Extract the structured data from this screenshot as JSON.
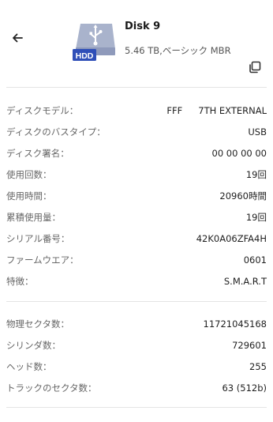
{
  "header": {
    "title": "Disk 9",
    "subtitle": "5.46 TB,ベーシック MBR",
    "icon_badge": "HDD"
  },
  "info_group_1": [
    {
      "label": "ディスクモデル：",
      "value_parts": [
        "FFF",
        "7TH EXTERNAL"
      ]
    },
    {
      "label": "ディスクのバスタイプ：",
      "value": "USB"
    },
    {
      "label": "ディスク署名：",
      "value": "00 00 00 00"
    },
    {
      "label": "使用回数：",
      "value": "19回"
    },
    {
      "label": "使用時間：",
      "value": "20960時間"
    },
    {
      "label": "累積使用量：",
      "value": "19回"
    },
    {
      "label": "シリアル番号：",
      "value": "42K0A06ZFA4H"
    },
    {
      "label": "ファームウエア：",
      "value": "0601"
    },
    {
      "label": "特徴：",
      "value": "S.M.A.R.T"
    }
  ],
  "info_group_2": [
    {
      "label": "物理セクタ数：",
      "value": "11721045168"
    },
    {
      "label": "シリンダ数：",
      "value": "729601"
    },
    {
      "label": "ヘッド数：",
      "value": "255"
    },
    {
      "label": "トラックのセクタ数：",
      "value": "63 (512b)"
    }
  ],
  "colors": {
    "disk_body": "#a9b3cc",
    "disk_badge": "#2f4fb8",
    "usb_symbol": "#ffffff"
  },
  "icons": {
    "back": "arrow-left-icon",
    "disk": "hdd-usb-icon",
    "copy": "copy-icon"
  }
}
